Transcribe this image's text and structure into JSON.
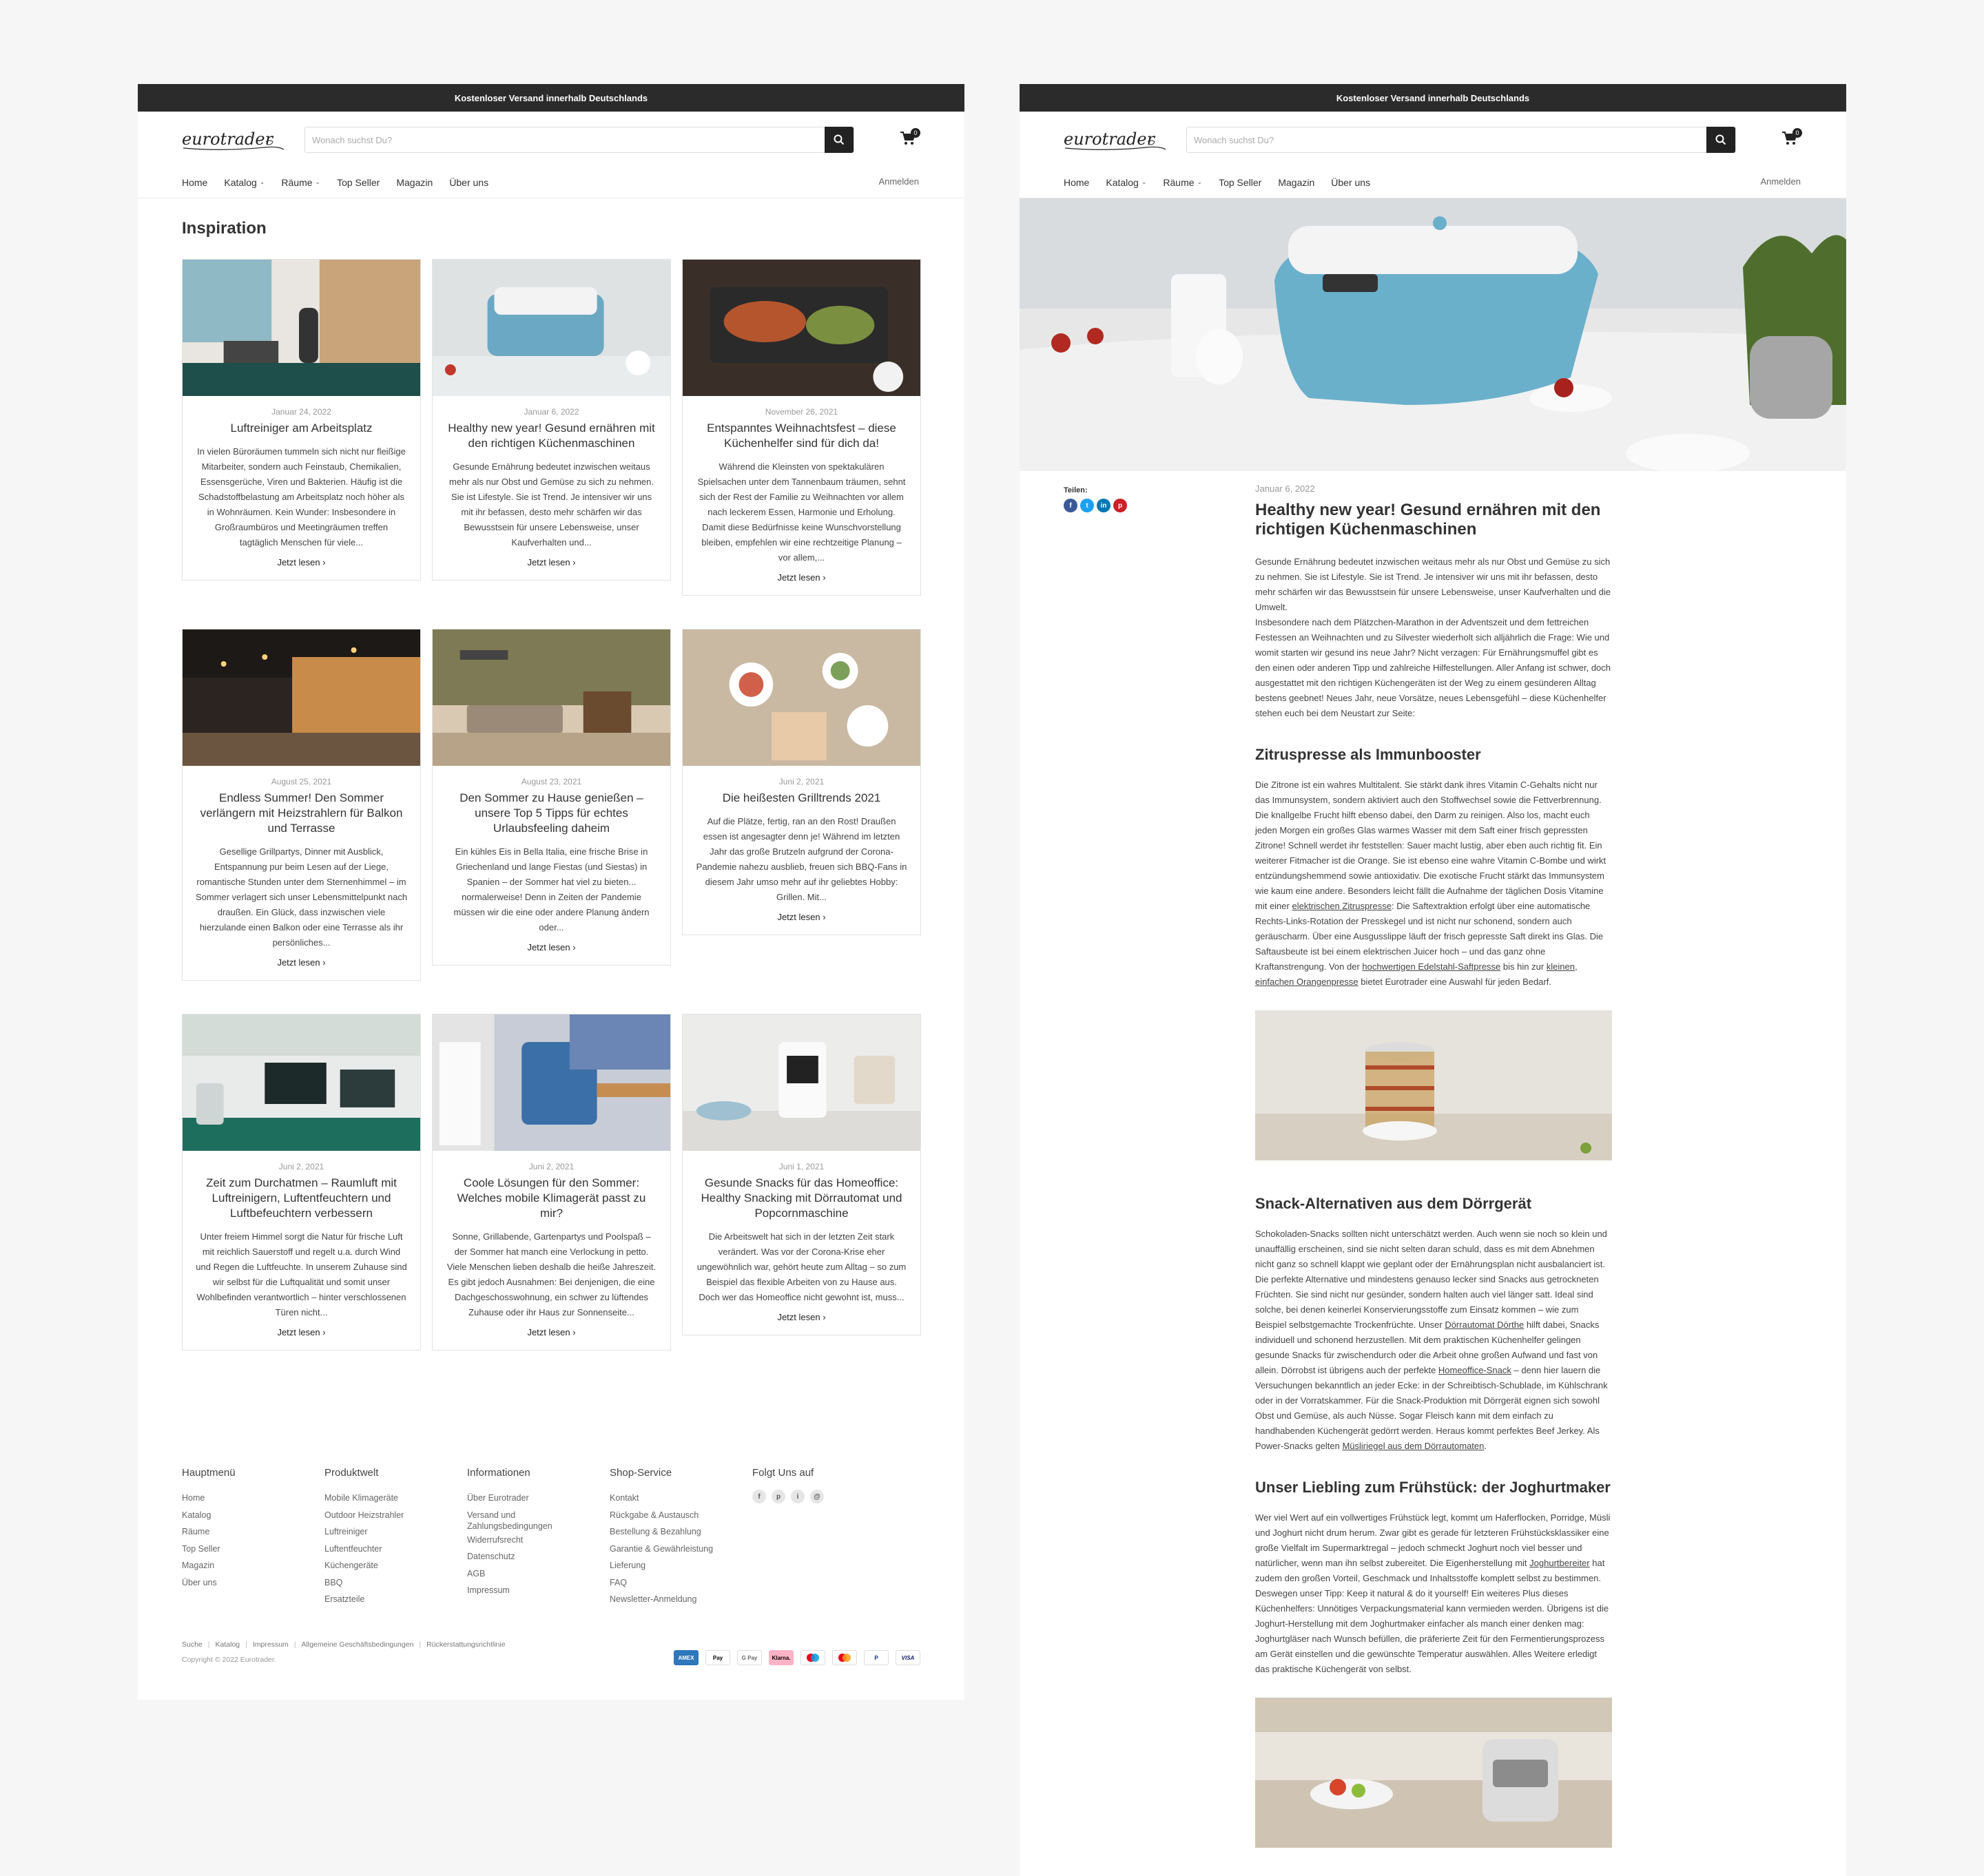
{
  "header": {
    "announcement": "Kostenloser Versand innerhalb Deutschlands",
    "logo_text": "eurotrader",
    "search_placeholder": "Wonach suchst Du?",
    "cart_count": "0",
    "nav": [
      "Home",
      "Katalog",
      "Räume",
      "Top Seller",
      "Magazin",
      "Über uns"
    ],
    "login": "Anmelden"
  },
  "inspiration": {
    "title": "Inspiration",
    "read_more": "Jetzt lesen",
    "cards": [
      {
        "date": "Januar 24, 2022",
        "title": "Luftreiniger am Arbeitsplatz",
        "excerpt": "In vielen Büroräumen tummeln sich nicht nur fleißige Mitarbeiter, sondern auch Feinstaub, Chemikalien, Essensgerüche, Viren und Bakterien. Häufig ist die Schadstoffbelastung am Arbeitsplatz noch höher als in Wohnräumen. Kein Wunder: Insbesondere in Großraumbüros und Meetingräumen treffen tagtäglich Menschen für viele..."
      },
      {
        "date": "Januar 6, 2022",
        "title": "Healthy new year! Gesund ernähren mit den richtigen Küchenmaschinen",
        "excerpt": "Gesunde Ernährung bedeutet inzwischen weitaus mehr als nur Obst und Gemüse zu sich zu nehmen. Sie ist Lifestyle. Sie ist Trend. Je intensiver wir uns mit ihr befassen, desto mehr schärfen wir das Bewusstsein für unsere Lebensweise, unser Kaufverhalten und..."
      },
      {
        "date": "November 26, 2021",
        "title": "Entspanntes Weihnachtsfest – diese Küchenhelfer sind für dich da!",
        "excerpt": "Während die Kleinsten von spektakulären Spielsachen unter dem Tannenbaum träumen, sehnt sich der Rest der Familie zu Weihnachten vor allem nach leckerem Essen, Harmonie und Erholung. Damit diese Bedürfnisse keine Wunschvorstellung bleiben, empfehlen wir eine rechtzeitige Planung – vor allem,..."
      },
      {
        "date": "August 25, 2021",
        "title": "Endless Summer! Den Sommer verlängern mit Heizstrahlern für Balkon und Terrasse",
        "excerpt": "Gesellige Grillpartys, Dinner mit Ausblick, Entspannung pur beim Lesen auf der Liege, romantische Stunden unter dem Sternenhimmel – im Sommer verlagert sich unser Lebensmittelpunkt nach draußen. Ein Glück, dass inzwischen viele hierzulande einen Balkon oder eine Terrasse als ihr persönliches..."
      },
      {
        "date": "August 23, 2021",
        "title": "Den Sommer zu Hause genießen – unsere Top 5 Tipps für echtes Urlaubsfeeling daheim",
        "excerpt": "Ein kühles Eis in Bella Italia, eine frische Brise in Griechenland und lange Fiestas (und Siestas) in Spanien – der Sommer hat viel zu bieten... normalerweise! Denn in Zeiten der Pandemie müssen wir die eine oder andere Planung ändern oder..."
      },
      {
        "date": "Juni 2, 2021",
        "title": "Die heißesten Grilltrends 2021",
        "excerpt": "Auf die Plätze, fertig, ran an den Rost! Draußen essen ist angesagter denn je! Während im letzten Jahr das große Brutzeln aufgrund der Corona-Pandemie nahezu ausblieb, freuen sich BBQ-Fans in diesem Jahr umso mehr auf ihr geliebtes Hobby: Grillen. Mit..."
      },
      {
        "date": "Juni 2, 2021",
        "title": "Zeit zum Durchatmen – Raumluft mit Luftreinigern, Luftentfeuchtern und Luftbefeuchtern verbessern",
        "excerpt": "Unter freiem Himmel sorgt die Natur für frische Luft mit reichlich Sauerstoff und regelt u.a. durch Wind und Regen die Luftfeuchte. In unserem Zuhause sind wir selbst für die Luftqualität und somit unser Wohlbefinden verantwortlich – hinter verschlossenen Türen nicht..."
      },
      {
        "date": "Juni 2, 2021",
        "title": "Coole Lösungen für den Sommer: Welches mobile Klimagerät passt zu mir?",
        "excerpt": "Sonne, Grillabende, Gartenpartys und Poolspaß – der Sommer hat manch eine Verlockung in petto. Viele Menschen lieben deshalb die heiße Jahreszeit. Es gibt jedoch Ausnahmen: Bei denjenigen, die eine Dachgeschosswohnung, ein schwer zu lüftendes Zuhause oder ihr Haus zur Sonnenseite..."
      },
      {
        "date": "Juni 1, 2021",
        "title": "Gesunde Snacks für das Homeoffice: Healthy Snacking mit Dörrautomat und Popcornmaschine",
        "excerpt": "Die Arbeitswelt hat sich in der letzten Zeit stark verändert. Was vor der Corona-Krise eher ungewöhnlich war, gehört heute zum Alltag – so zum Beispiel das flexible Arbeiten von zu Hause aus. Doch wer das Homeoffice nicht gewohnt ist, muss..."
      }
    ]
  },
  "footer": {
    "columns": [
      {
        "title": "Hauptmenü",
        "links": [
          "Home",
          "Katalog",
          "Räume",
          "Top Seller",
          "Magazin",
          "Über uns"
        ]
      },
      {
        "title": "Produktwelt",
        "links": [
          "Mobile Klimageräte",
          "Outdoor Heizstrahler",
          "Luftreiniger",
          "Luftentfeuchter",
          "Küchengeräte",
          "BBQ",
          "Ersatzteile"
        ]
      },
      {
        "title": "Informationen",
        "links": [
          "Über Eurotrader",
          "Versand und",
          "Zahlungsbedingungen",
          "Widerrufsrecht",
          "Datenschutz",
          "AGB",
          "Impressum"
        ]
      },
      {
        "title": "Shop-Service",
        "links": [
          "Kontakt",
          "Rückgabe & Austausch",
          "Bestellung & Bezahlung",
          "Garantie & Gewährleistung",
          "Lieferung",
          "FAQ",
          "Newsletter-Anmeldung"
        ]
      }
    ],
    "follow_title": "Folgt Uns auf",
    "social": [
      "f",
      "p",
      "i",
      "@"
    ],
    "legal_links": [
      "Suche",
      "Katalog",
      "Impressum",
      "Allgemeine Geschäftsbedingungen",
      "Rückerstattungsrichtlinie"
    ],
    "copyright": "Copyright © 2022 Eurotrader.",
    "payments": [
      "AMEX",
      "Pay",
      "G Pay",
      "Klarna.",
      "",
      "",
      "P",
      "VISA"
    ]
  },
  "article": {
    "share_label": "Teilen:",
    "date": "Januar 6, 2022",
    "title": "Healthy new year! Gesund ernähren mit den richtigen Küchenmaschinen",
    "intro1": "Gesunde Ernährung bedeutet inzwischen weitaus mehr als nur Obst und Gemüse zu sich zu nehmen. Sie ist Lifestyle. Sie ist Trend. Je intensiver wir uns mit ihr befassen, desto mehr schärfen wir das Bewusstsein für unsere Lebensweise, unser Kaufverhalten und die Umwelt.",
    "intro2": "Insbesondere nach dem Plätzchen-Marathon in der Adventszeit und dem fettreichen Festessen an Weihnachten und zu Silvester wiederholt sich alljährlich die Frage: Wie und womit starten wir gesund ins neue Jahr? Nicht verzagen: Für Ernährungsmuffel gibt es den einen oder anderen Tipp und zahlreiche Hilfestellungen. Aller Anfang ist schwer, doch ausgestattet mit den richtigen Küchengeräten ist der Weg zu einem gesünderen Alltag bestens geebnet! Neues Jahr, neue Vorsätze, neues Lebensgefühl – diese Küchenhelfer stehen euch bei dem Neustart zur Seite:",
    "h2_1": "Zitruspresse als Immunbooster",
    "p1_a": "Die Zitrone ist ein wahres Multitalent. Sie stärkt dank ihres Vitamin C-Gehalts nicht nur das Immunsystem, sondern aktiviert auch den Stoffwechsel sowie die Fettverbrennung. Die knallgelbe Frucht hilft ebenso dabei, den Darm zu reinigen. Also los, macht euch jeden Morgen ein großes Glas warmes Wasser mit dem Saft einer frisch gepressten Zitrone! Schnell werdet ihr feststellen: Sauer macht lustig, aber eben auch richtig fit. Ein weiterer Fitmacher ist die Orange. Sie ist ebenso eine wahre Vitamin C-Bombe und wirkt entzündungshemmend sowie antioxidativ. Die exotische Frucht stärkt das Immunsystem wie kaum eine andere. Besonders leicht fällt die Aufnahme der täglichen Dosis Vitamine mit einer ",
    "p1_link1": "elektrischen Zitruspresse",
    "p1_b": ": Die Saftextraktion erfolgt über eine automatische Rechts-Links-Rotation der Presskegel und ist nicht nur schonend, sondern auch geräuscharm. Über eine Ausgusslippe läuft der frisch gepresste Saft direkt ins Glas. Die Saftausbeute ist bei einem elektrischen Juicer hoch – und das ganz ohne Kraftanstrengung. Von der ",
    "p1_link2": "hochwertigen Edelstahl-Saftpresse",
    "p1_c": " bis hin zur ",
    "p1_link3": "kleinen, einfachen Orangenpresse",
    "p1_d": " bietet Eurotrader eine Auswahl für jeden Bedarf.",
    "h2_2": "Snack-Alternativen aus dem Dörrgerät",
    "p2_a": "Schokoladen-Snacks sollten nicht unterschätzt werden. Auch wenn sie noch so klein und unauffällig erscheinen, sind sie nicht selten daran schuld, dass es mit dem Abnehmen nicht ganz so schnell klappt wie geplant oder der Ernährungsplan nicht ausbalanciert ist. Die perfekte Alternative und mindestens genauso lecker sind Snacks aus getrockneten Früchten. Sie sind nicht nur gesünder, sondern halten auch viel länger satt. Ideal sind solche, bei denen keinerlei Konservierungsstoffe zum Einsatz kommen – wie zum Beispiel selbstgemachte Trockenfrüchte. Unser ",
    "p2_link1": "Dörrautomat Dörthe",
    "p2_b": " hilft dabei, Snacks individuell und schonend herzustellen. Mit dem praktischen Küchenhelfer gelingen gesunde Snacks für zwischendurch oder die Arbeit ohne großen Aufwand und fast von allein. Dörrobst ist übrigens auch der perfekte ",
    "p2_link2": "Homeoffice-Snack",
    "p2_c": " – denn hier lauern die Versuchungen bekanntlich an jeder Ecke: in der Schreibtisch-Schublade, im Kühlschrank oder in der Vorratskammer. Für die Snack-Produktion mit Dörrgerät eignen sich sowohl Obst und Gemüse, als auch Nüsse. Sogar Fleisch kann mit dem einfach zu handhabenden Küchengerät gedörrt werden. Heraus kommt perfektes Beef Jerkey. Als Power-Snacks gelten ",
    "p2_link3": "Müsliriegel aus dem Dörrautomaten",
    "p2_d": ".",
    "h2_3": "Unser Liebling zum Frühstück: der Joghurtmaker",
    "p3_a": "Wer viel Wert auf ein vollwertiges Frühstück legt, kommt um Haferflocken, Porridge, Müsli und Joghurt nicht drum herum. Zwar gibt es gerade für letzteren Frühstücksklassiker eine große Vielfalt im Supermarktregal – jedoch schmeckt Joghurt noch viel besser und natürlicher, wenn man ihn selbst zubereitet. Die Eigenherstellung mit ",
    "p3_link1": "Joghurtbereiter",
    "p3_b": " hat zudem den großen Vorteil, Geschmack und Inhaltsstoffe komplett selbst zu bestimmen. Deswegen unser Tipp: Keep it natural & do it yourself! Ein weiteres Plus dieses Küchenhelfers: Unnötiges Verpackungsmaterial kann vermieden werden. Übrigens ist die Joghurt-Herstellung mit dem Joghurtmaker einfacher als manch einer denken mag: Joghurtgläser nach Wunsch befüllen, die präferierte Zeit für den Fermentierungsprozess am Gerät einstellen und die gewünschte Temperatur auswählen. Alles Weitere erledigt das praktische Küchengerät von selbst.",
    "share": [
      {
        "label": "f",
        "color": "#3b5998"
      },
      {
        "label": "t",
        "color": "#1da1f2"
      },
      {
        "label": "in",
        "color": "#0077b5"
      },
      {
        "label": "p",
        "color": "#cb2027"
      }
    ]
  }
}
